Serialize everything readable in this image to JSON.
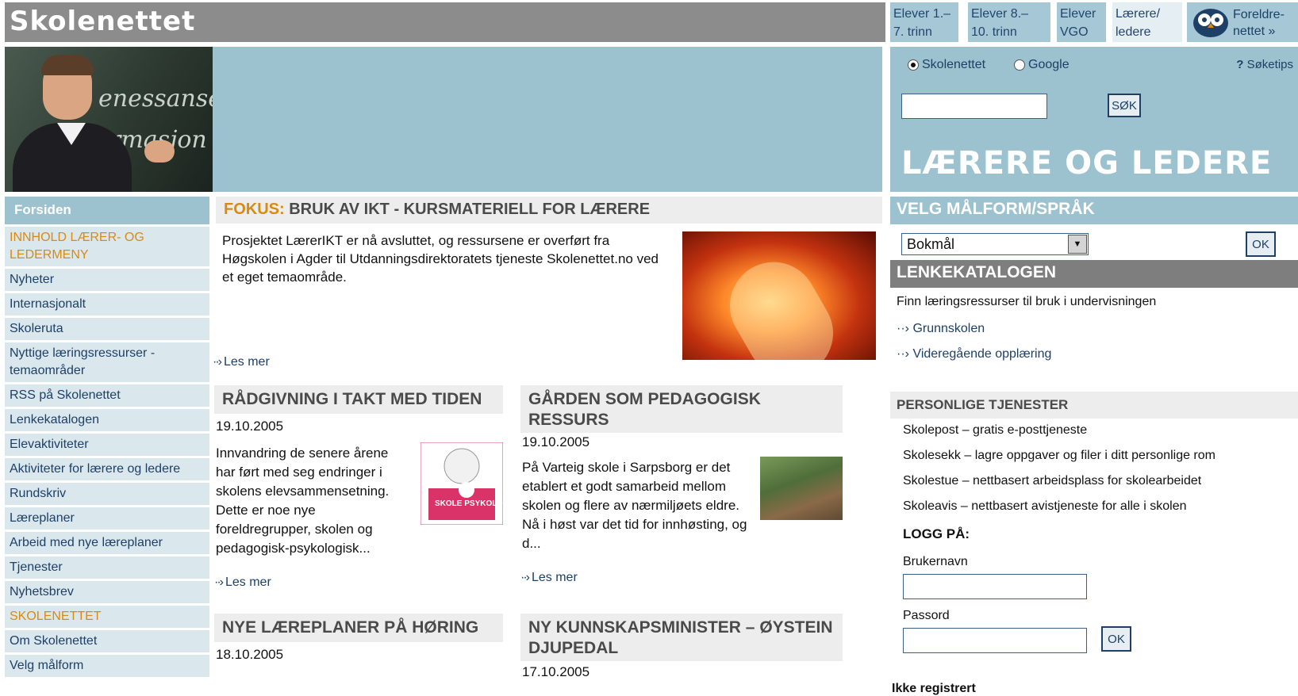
{
  "site": {
    "title": "Skolenettet"
  },
  "tabs": [
    {
      "line1": "Elever 1.–",
      "line2": "7. trinn"
    },
    {
      "line1": "Elever 8.–",
      "line2": "10. trinn"
    },
    {
      "line1": "Elever",
      "line2": "VGO"
    },
    {
      "line1": "Lærere/",
      "line2": "ledere"
    }
  ],
  "parent_tab": {
    "line1": "Foreldre-",
    "line2": "nettet »"
  },
  "banner": {
    "chalk1": "enessanse",
    "chalk2": "rmasjon"
  },
  "search": {
    "option_skolenettet": "Skolenettet",
    "option_google": "Google",
    "tips": "Søketips",
    "button": "SØK",
    "audience": "LÆRERE OG LEDERE"
  },
  "leftnav": {
    "home": "Forsiden",
    "items": [
      {
        "label": "INNHOLD LÆRER- OG LEDERMENY"
      },
      {
        "label": "Nyheter"
      },
      {
        "label": "Internasjonalt"
      },
      {
        "label": "Skoleruta"
      },
      {
        "label": "Nyttige læringsressurser - temaområder"
      },
      {
        "label": "RSS på Skolenettet"
      },
      {
        "label": "Lenkekatalogen"
      },
      {
        "label": "Elevaktiviteter"
      },
      {
        "label": "Aktiviteter for lærere og ledere"
      },
      {
        "label": "Rundskriv"
      },
      {
        "label": "Læreplaner"
      },
      {
        "label": "Arbeid med nye læreplaner"
      },
      {
        "label": "Tjenester"
      },
      {
        "label": "Nyhetsbrev"
      },
      {
        "label": "SKOLENETTET"
      },
      {
        "label": "Om Skolenettet"
      },
      {
        "label": "Velg målform"
      }
    ]
  },
  "focus": {
    "label": "FOKUS:",
    "title": "BRUK AV IKT - KURSMATERIELL FOR LÆRERE",
    "text": "Prosjektet LærerIKT er nå avsluttet, og ressursene er overført fra Høgskolen i Agder til Utdanningsdirektoratets tjeneste Skolenettet.no ved et eget temaområde.",
    "more": "Les mer"
  },
  "articles": [
    {
      "title": "RÅDGIVNING I TAKT MED TIDEN",
      "date": "19.10.2005",
      "text": "Innvandring de senere årene har ført med seg endringer i skolens elevsammensetning. Dette er noe nye foreldregrupper, skolen og pedagogisk-psykologisk...",
      "more": "Les mer",
      "image_text": "SKOLE PSYKOLOGI"
    },
    {
      "title": "GÅRDEN SOM PEDAGOGISK RESSURS",
      "date": "19.10.2005",
      "text": "På Varteig skole i Sarpsborg er det etablert et godt samarbeid mellom skolen og flere av nærmiljøets eldre. Nå i høst var det tid for innhøsting, og d...",
      "more": "Les mer"
    },
    {
      "title": "NYE LÆREPLANER PÅ HØRING",
      "date": "18.10.2005"
    },
    {
      "title": "NY KUNNSKAPSMINISTER – ØYSTEIN DJUPEDAL",
      "date": "17.10.2005"
    }
  ],
  "right": {
    "lang_head": "VELG MÅLFORM/SPRÅK",
    "lang_selected": "Bokmål",
    "ok": "OK",
    "catalog_head": "LENKEKATALOGEN",
    "catalog_text": "Finn læringsressurser til bruk i undervisningen",
    "catalog_links": [
      "Grunnskolen",
      "Videregående opplæring"
    ],
    "personal_head": "PERSONLIGE TJENESTER",
    "personal_items": [
      "Skolepost – gratis e-posttjeneste",
      "Skolesekk – lagre oppgaver og filer i ditt personlige rom",
      "Skolestue – nettbasert arbeidsplass for skolearbeidet",
      "Skoleavis – nettbasert avistjeneste for alle i skolen"
    ],
    "login_title": "LOGG PÅ:",
    "username_label": "Brukernavn",
    "password_label": "Passord",
    "not_registered": "Ikke registrert"
  },
  "colors": {
    "accent_blue": "#9cc2cf",
    "nav_bg": "#dae8ee",
    "link": "#1e3f66",
    "orange": "#d98a12",
    "grey_bar": "#8c8c8c"
  }
}
